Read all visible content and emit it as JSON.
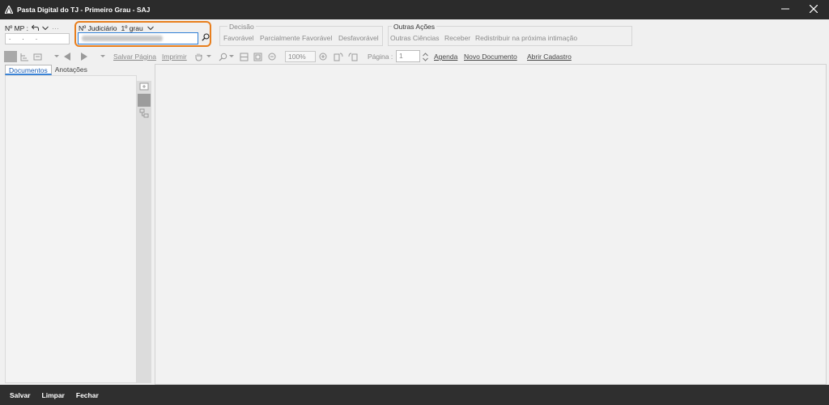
{
  "window": {
    "title": "Pasta Digital do TJ - Primeiro Grau - SAJ",
    "minimize_icon": "minimize-icon",
    "close_icon": "close-icon"
  },
  "search": {
    "mp_label": "Nº MP :",
    "mp_value": ". . .",
    "jud_label": "Nº Judiciário",
    "jud_grau": "1º grau",
    "search_icon": "magnifier-icon"
  },
  "decisao": {
    "title": "Decisão",
    "items": [
      "Favorável",
      "Parcialmente Favorável",
      "Desfavorável"
    ]
  },
  "outras_acoes": {
    "title": "Outras Ações",
    "items": [
      "Outras Ciências",
      "Receber",
      "Redistribuir na próxima intimação"
    ]
  },
  "toolbar": {
    "salvar_pagina": "Salvar Página",
    "imprimir": "Imprimir",
    "zoom": "100%",
    "pagina_label": "Página :",
    "pagina_value": "1",
    "agenda": "Agenda",
    "novo_documento": "Novo Documento",
    "abrir_cadastro": "Abrir Cadastro"
  },
  "left_panel": {
    "tabs": [
      "Documentos",
      "Anotações"
    ],
    "active_tab": "Documentos"
  },
  "footer": {
    "salvar": "Salvar",
    "limpar": "Limpar",
    "fechar": "Fechar"
  },
  "colors": {
    "titlebar": "#2b2b2b",
    "highlight": "#e87f1e",
    "input_focus": "#2f7fd6",
    "footer": "#2f2f2f"
  }
}
